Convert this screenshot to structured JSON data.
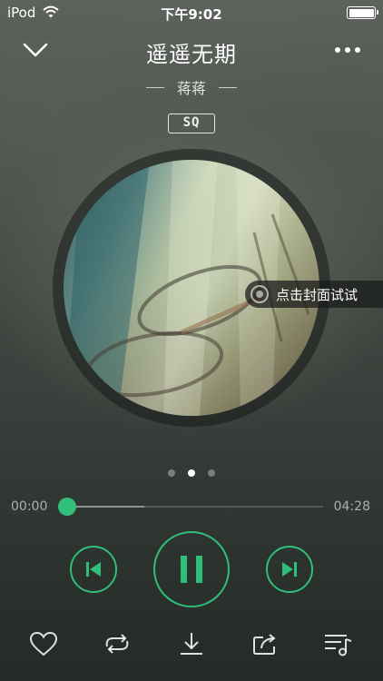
{
  "status_bar": {
    "carrier": "iPod",
    "time": "下午9:02"
  },
  "header": {
    "title": "遥遥无期",
    "artist": "蒋蒋",
    "quality_badge": "SQ"
  },
  "album": {
    "hint_text": "点击封面试试"
  },
  "pager": {
    "count": 3,
    "active_index": 1
  },
  "progress": {
    "current_time": "00:00",
    "total_time": "04:28",
    "played_fraction": 0.0,
    "buffered_fraction": 0.3
  },
  "controls": {
    "state": "playing"
  },
  "colors": {
    "accent": "#2fbf78"
  },
  "icons": {
    "back": "chevron-down-icon",
    "more": "more-dots-icon",
    "prev": "skip-previous-icon",
    "pause": "pause-icon",
    "next": "skip-next-icon",
    "like": "heart-icon",
    "loop": "repeat-icon",
    "download": "download-icon",
    "share": "share-icon",
    "playlist": "playlist-icon"
  }
}
